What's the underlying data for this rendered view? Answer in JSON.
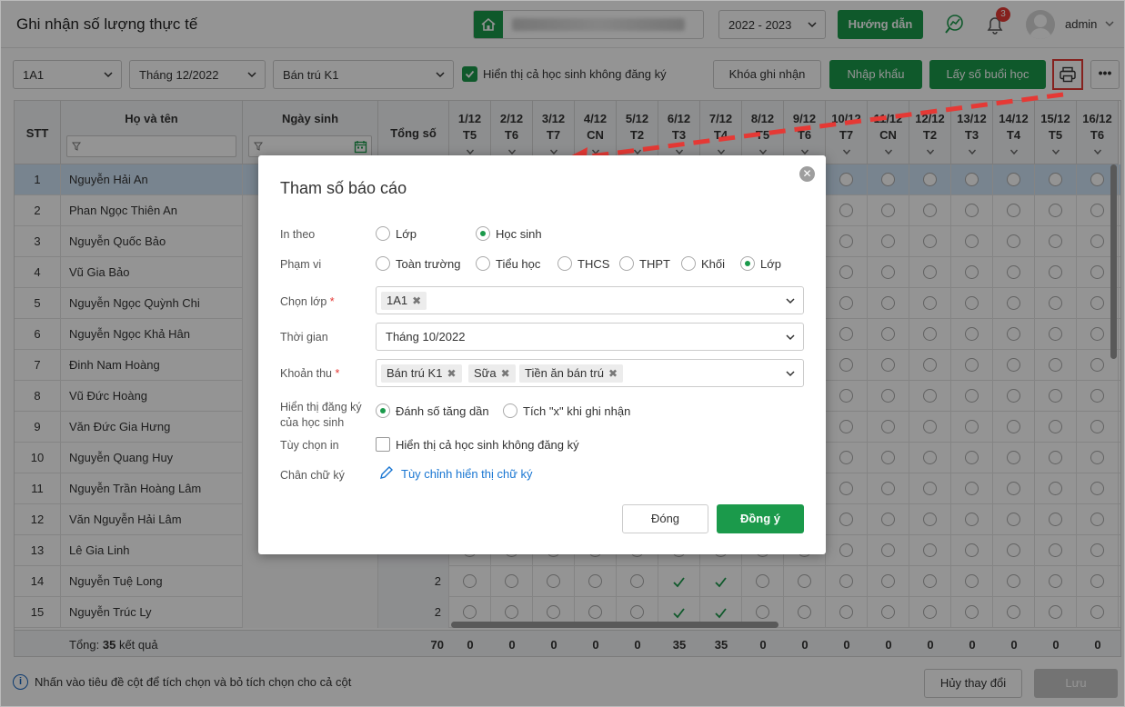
{
  "header": {
    "title": "Ghi nhận số lượng thực tế",
    "school_year": "2022 - 2023",
    "guide_label": "Hướng dẫn",
    "notification_count": "3",
    "user_name": "admin"
  },
  "toolbar": {
    "class_value": "1A1",
    "month_value": "Tháng 12/2022",
    "fee_value": "Bán trú K1",
    "show_unregistered_label": "Hiển thị cả học sinh không đăng ký",
    "lock_label": "Khóa ghi nhận",
    "import_label": "Nhập khẩu",
    "fetch_label": "Lấy số buổi học",
    "more_label": "•••"
  },
  "table": {
    "col_stt": "STT",
    "col_name": "Họ và tên",
    "col_dob": "Ngày sinh",
    "col_total": "Tổng số",
    "days": [
      {
        "d": "1/12",
        "w": "T5"
      },
      {
        "d": "2/12",
        "w": "T6"
      },
      {
        "d": "3/12",
        "w": "T7"
      },
      {
        "d": "4/12",
        "w": "CN"
      },
      {
        "d": "5/12",
        "w": "T2"
      },
      {
        "d": "6/12",
        "w": "T3"
      },
      {
        "d": "7/12",
        "w": "T4"
      },
      {
        "d": "8/12",
        "w": "T5"
      },
      {
        "d": "9/12",
        "w": "T6"
      },
      {
        "d": "10/12",
        "w": "T7"
      },
      {
        "d": "11/12",
        "w": "CN"
      },
      {
        "d": "12/12",
        "w": "T2"
      },
      {
        "d": "13/12",
        "w": "T3"
      },
      {
        "d": "14/12",
        "w": "T4"
      },
      {
        "d": "15/12",
        "w": "T5"
      },
      {
        "d": "16/12",
        "w": "T6"
      }
    ],
    "rows": [
      {
        "stt": "1",
        "name": "Nguyễn Hải An",
        "total": "",
        "checks": []
      },
      {
        "stt": "2",
        "name": "Phan Ngọc Thiên An",
        "total": "",
        "checks": []
      },
      {
        "stt": "3",
        "name": "Nguyễn Quốc Bảo",
        "total": "",
        "checks": []
      },
      {
        "stt": "4",
        "name": "Vũ Gia Bảo",
        "total": "",
        "checks": []
      },
      {
        "stt": "5",
        "name": "Nguyễn Ngọc Quỳnh Chi",
        "total": "",
        "checks": []
      },
      {
        "stt": "6",
        "name": "Nguyễn Ngọc Khả Hân",
        "total": "",
        "checks": []
      },
      {
        "stt": "7",
        "name": "Đinh Nam Hoàng",
        "total": "",
        "checks": []
      },
      {
        "stt": "8",
        "name": "Vũ Đức Hoàng",
        "total": "",
        "checks": []
      },
      {
        "stt": "9",
        "name": "Văn Đức Gia Hưng",
        "total": "",
        "checks": []
      },
      {
        "stt": "10",
        "name": "Nguyễn Quang Huy",
        "total": "",
        "checks": []
      },
      {
        "stt": "11",
        "name": "Nguyễn Trần Hoàng Lâm",
        "total": "",
        "checks": []
      },
      {
        "stt": "12",
        "name": "Văn Nguyễn Hải Lâm",
        "total": "",
        "checks": []
      },
      {
        "stt": "13",
        "name": "Lê Gia Linh",
        "total": "",
        "checks": []
      },
      {
        "stt": "14",
        "name": "Nguyễn Tuệ Long",
        "total": "2",
        "checks": [
          5,
          6
        ]
      },
      {
        "stt": "15",
        "name": "Nguyễn Trúc Ly",
        "total": "2",
        "checks": [
          5,
          6
        ]
      }
    ],
    "footer_prefix": "Tổng: ",
    "footer_count": "35",
    "footer_suffix": " kết quả",
    "footer_total": "70",
    "footer_days": [
      "0",
      "0",
      "0",
      "0",
      "0",
      "35",
      "35",
      "0",
      "0",
      "0",
      "0",
      "0",
      "0",
      "0",
      "0",
      "0"
    ]
  },
  "bottom": {
    "info_text": "Nhấn vào tiêu đề cột để tích chọn và bỏ tích chọn cho cả cột",
    "cancel_label": "Hủy thay đổi",
    "save_label": "Lưu"
  },
  "modal": {
    "title": "Tham số báo cáo",
    "print_by_label": "In theo",
    "print_by_options": [
      "Lớp",
      "Học sinh"
    ],
    "scope_label": "Phạm vi",
    "scope_options": [
      "Toàn trường",
      "Tiểu học",
      "THCS",
      "THPT",
      "Khối",
      "Lớp"
    ],
    "class_label": "Chọn lớp",
    "class_tags": [
      "1A1"
    ],
    "time_label": "Thời gian",
    "time_value": "Tháng 10/2022",
    "fee_label": "Khoản thu",
    "fee_tags": [
      "Bán trú K1",
      "Sữa",
      "Tiền ăn bán trú"
    ],
    "display_label_1": "Hiển thị đăng ký",
    "display_label_2": "của học sinh",
    "display_options": [
      "Đánh số tăng dần",
      "Tích \"x\" khi ghi nhận"
    ],
    "print_option_label": "Tùy chọn in",
    "print_option_value": "Hiển thị cả học sinh không đăng ký",
    "signature_label": "Chân chữ ký",
    "signature_link": "Tùy chỉnh hiển thị chữ ký",
    "close_label": "Đóng",
    "ok_label": "Đồng ý"
  }
}
